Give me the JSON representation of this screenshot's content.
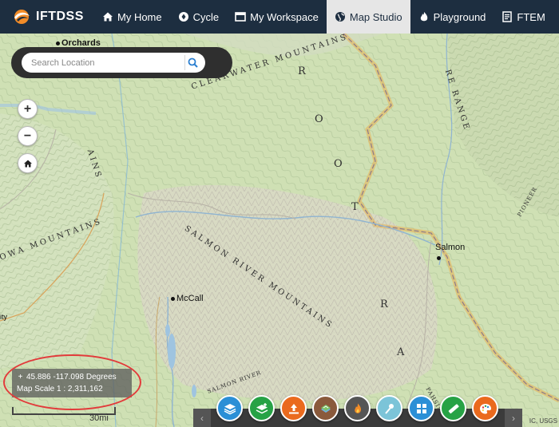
{
  "nav": {
    "brand": "IFTDSS",
    "items": [
      {
        "label": "My Home",
        "icon": "home-icon",
        "active": false
      },
      {
        "label": "Cycle",
        "icon": "cycle-icon",
        "active": false
      },
      {
        "label": "My Workspace",
        "icon": "workspace-icon",
        "active": false
      },
      {
        "label": "Map Studio",
        "icon": "globe-icon",
        "active": true
      },
      {
        "label": "Playground",
        "icon": "fire-icon",
        "active": false
      },
      {
        "label": "FTEM",
        "icon": "document-icon",
        "active": false
      }
    ]
  },
  "search": {
    "placeholder": "Search Location"
  },
  "zoom": {
    "in": "+",
    "out": "−",
    "home": "home-icon"
  },
  "coords": {
    "text": "45.886 -117.098 Degrees",
    "scale": "Map Scale 1 : 2,311,162"
  },
  "scalebar": {
    "label": "30mi"
  },
  "map_labels": {
    "clearwater": "CLEARWATER MOUNTAINS",
    "salmon_river": "SALMON RIVER MOUNTAINS",
    "bitterroot_r": "R",
    "bitterroot_o1": "O",
    "bitterroot_o2": "O",
    "bitterroot_t": "T",
    "bitterroot_r2": "R",
    "bitterroot_a": "A",
    "beaverhead_range": "RE RANGE",
    "wallowa": "OWA MOUNTAINS",
    "left_ains": "AINS",
    "pioneer": "PIONEER",
    "lost_river": "SALMON RIVER",
    "pahsimeroi": "PAHSIMERO",
    "elk": "ORCHARDS"
  },
  "towns": {
    "orchards": "Orchards",
    "mccall": "McCall",
    "salmon": "Salmon",
    "city": "ity"
  },
  "attribution": "IC, USGS",
  "toolbar": {
    "left_arrow": "‹",
    "right_arrow": "›",
    "tools": [
      {
        "name": "layers-tool",
        "color": "#2b8fd6"
      },
      {
        "name": "add-layers-tool",
        "color": "#27a245"
      },
      {
        "name": "upload-tool",
        "color": "#ea6a1e"
      },
      {
        "name": "terrain-tool",
        "color": "#8a5a3c"
      },
      {
        "name": "fire-tool",
        "color": "#555555"
      },
      {
        "name": "draw-tool",
        "color": "#7cc4d8"
      },
      {
        "name": "grid-tool",
        "color": "#2b8fd6"
      },
      {
        "name": "measure-tool",
        "color": "#27a245"
      },
      {
        "name": "palette-tool",
        "color": "#ea6a1e"
      }
    ]
  }
}
